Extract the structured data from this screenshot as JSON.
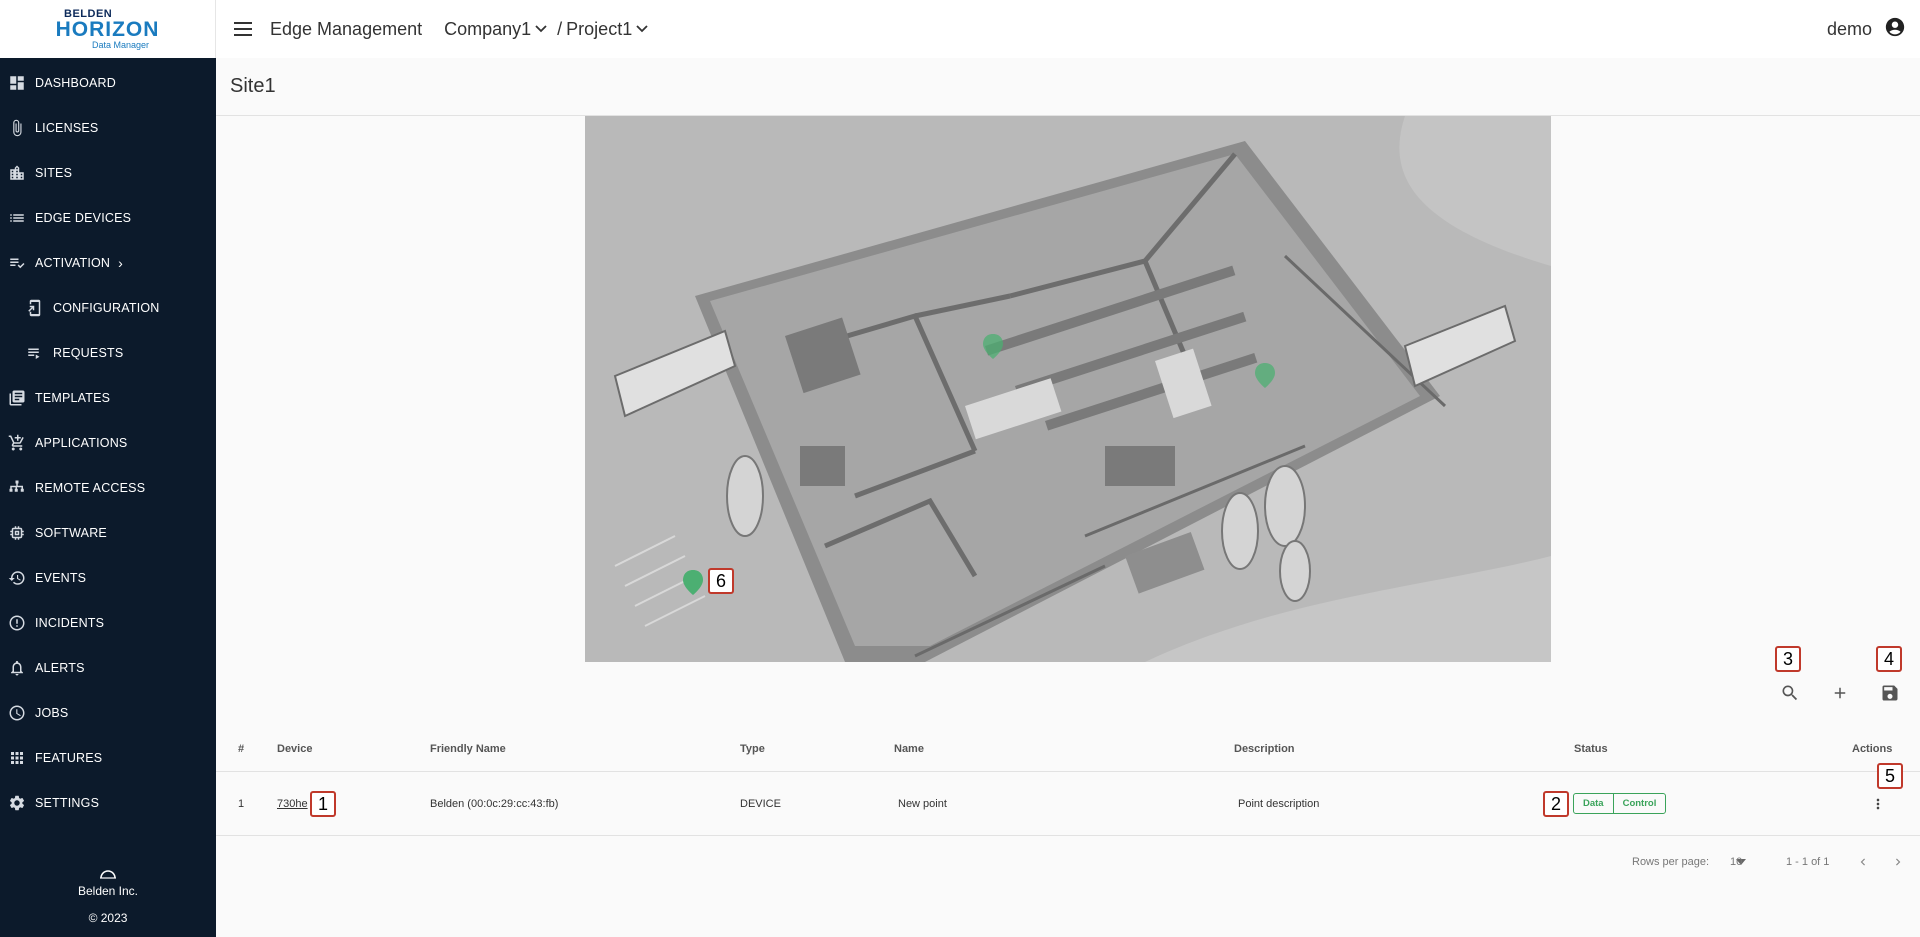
{
  "logo": {
    "brand": "BELDEN",
    "product": "HORIZON",
    "tagline": "Data Manager"
  },
  "sidebar": {
    "items": [
      {
        "label": "DASHBOARD",
        "icon": "dashboard-icon"
      },
      {
        "label": "LICENSES",
        "icon": "paperclip-icon"
      },
      {
        "label": "SITES",
        "icon": "building-icon"
      },
      {
        "label": "EDGE DEVICES",
        "icon": "list-icon"
      },
      {
        "label": "ACTIVATION",
        "icon": "checklist-icon"
      },
      {
        "label": "CONFIGURATION",
        "icon": "device-config-icon"
      },
      {
        "label": "REQUESTS",
        "icon": "queue-icon"
      },
      {
        "label": "TEMPLATES",
        "icon": "library-icon"
      },
      {
        "label": "APPLICATIONS",
        "icon": "cart-icon"
      },
      {
        "label": "REMOTE ACCESS",
        "icon": "network-icon"
      },
      {
        "label": "SOFTWARE",
        "icon": "chip-icon"
      },
      {
        "label": "EVENTS",
        "icon": "history-icon"
      },
      {
        "label": "INCIDENTS",
        "icon": "alert-circle-icon"
      },
      {
        "label": "ALERTS",
        "icon": "bell-icon"
      },
      {
        "label": "JOBS",
        "icon": "clock-icon"
      },
      {
        "label": "FEATURES",
        "icon": "apps-grid-icon"
      },
      {
        "label": "SETTINGS",
        "icon": "gear-icon"
      }
    ],
    "footer": {
      "company": "Belden Inc.",
      "copyright": "© 2023"
    }
  },
  "topbar": {
    "app_title": "Edge Management",
    "company": "Company1",
    "separator": "/",
    "project": "Project1",
    "user": "demo"
  },
  "page": {
    "title": "Site1"
  },
  "map": {
    "marker_labels": {
      "m1": "6"
    }
  },
  "toolbar": {
    "labels": {
      "search": "3",
      "save": "4"
    }
  },
  "table": {
    "headers": [
      "#",
      "Device",
      "Friendly Name",
      "Type",
      "Name",
      "Description",
      "Status",
      "Actions"
    ],
    "row": {
      "index": "1",
      "device": "730he",
      "device_tag": "1",
      "friendly_name": "Belden (00:0c:29:cc:43:fb)",
      "type": "DEVICE",
      "name": "New point",
      "description": "Point description",
      "status_tag": "2",
      "status_chips": [
        "Data",
        "Control"
      ],
      "actions_tag": "5"
    }
  },
  "pager": {
    "rows_per_page_label": "Rows per page:",
    "rows_per_page": "10",
    "range": "1 - 1 of 1"
  },
  "colors": {
    "sidebar_bg": "#0c1a2b",
    "status_green": "#3aa35a",
    "marker_green": "#4caf72",
    "tag_border": "#c0392b"
  }
}
